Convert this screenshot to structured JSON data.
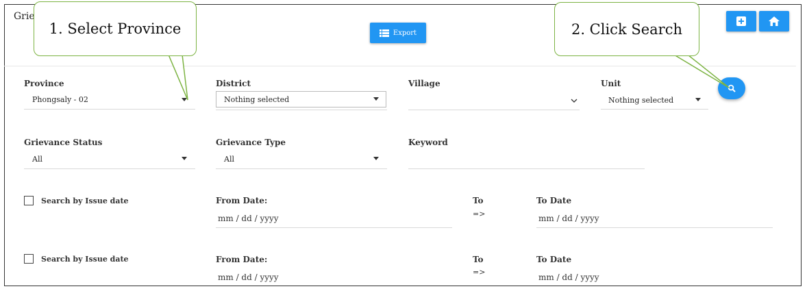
{
  "page": {
    "title": "Grie"
  },
  "toolbar": {
    "export_label": "Export",
    "add_icon": "plus-icon",
    "home_icon": "home-icon",
    "search_icon": "magnifier-icon"
  },
  "filters": {
    "province": {
      "label": "Province",
      "value": "Phongsaly - 02"
    },
    "district": {
      "label": "District",
      "value": "Nothing selected"
    },
    "village": {
      "label": "Village",
      "value": ""
    },
    "unit": {
      "label": "Unit",
      "value": "Nothing selected"
    },
    "status": {
      "label": "Grievance Status",
      "value": "All"
    },
    "type": {
      "label": "Grievance Type",
      "value": "All"
    },
    "keyword": {
      "label": "Keyword",
      "value": ""
    }
  },
  "date_rows": [
    {
      "checkbox_label": "Search by Issue date",
      "from_label": "From Date:",
      "from_placeholder": "mm / dd / yyyy",
      "to_label": "To",
      "arrow": "=>",
      "todate_label": "To Date",
      "to_placeholder": "mm / dd / yyyy"
    },
    {
      "checkbox_label": "Search by Issue date",
      "from_label": "From Date:",
      "from_placeholder": "mm / dd / yyyy",
      "to_label": "To",
      "arrow": "=>",
      "todate_label": "To Date",
      "to_placeholder": "mm / dd / yyyy"
    }
  ],
  "callouts": {
    "step1": "1. Select Province",
    "step2": "2. Click Search"
  },
  "colors": {
    "primary": "#2196f3",
    "callout_border": "#7cb342"
  }
}
